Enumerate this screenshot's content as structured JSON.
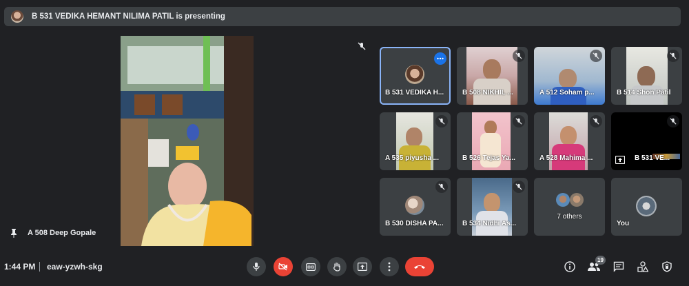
{
  "banner": {
    "text": "B 531 VEDIKA HEMANT NILIMA PATIL is presenting"
  },
  "main_video": {
    "name": "A 508 Deep Gopale"
  },
  "tiles": [
    {
      "name": "B 531 VEDIKA H...",
      "muted": false,
      "active": true
    },
    {
      "name": "B 508 NIKHIL ...",
      "muted": true
    },
    {
      "name": "A 512 Soham p...",
      "muted": true
    },
    {
      "name": "B 514 Shon Patil",
      "muted": true
    },
    {
      "name": "A 535 piyusha ...",
      "muted": true
    },
    {
      "name": "B 526 Tejas Ya...",
      "muted": true
    },
    {
      "name": "A 528 Mahima ...",
      "muted": true
    },
    {
      "name": "B 531 VE...",
      "muted": true
    },
    {
      "name": "B 530 DISHA PA...",
      "muted": true
    },
    {
      "name": "B 534 Nidhi As...",
      "muted": true
    },
    {
      "name": "7 others",
      "muted": false
    },
    {
      "name": "You",
      "muted": false
    }
  ],
  "bottom": {
    "time": "1:44 PM",
    "meeting_code": "eaw-yzwh-skg",
    "participant_count": "19"
  },
  "colors": {
    "background": "#202124",
    "tile": "#3c4043",
    "accent_blue": "#8ab4f8",
    "danger_red": "#ea4335"
  }
}
